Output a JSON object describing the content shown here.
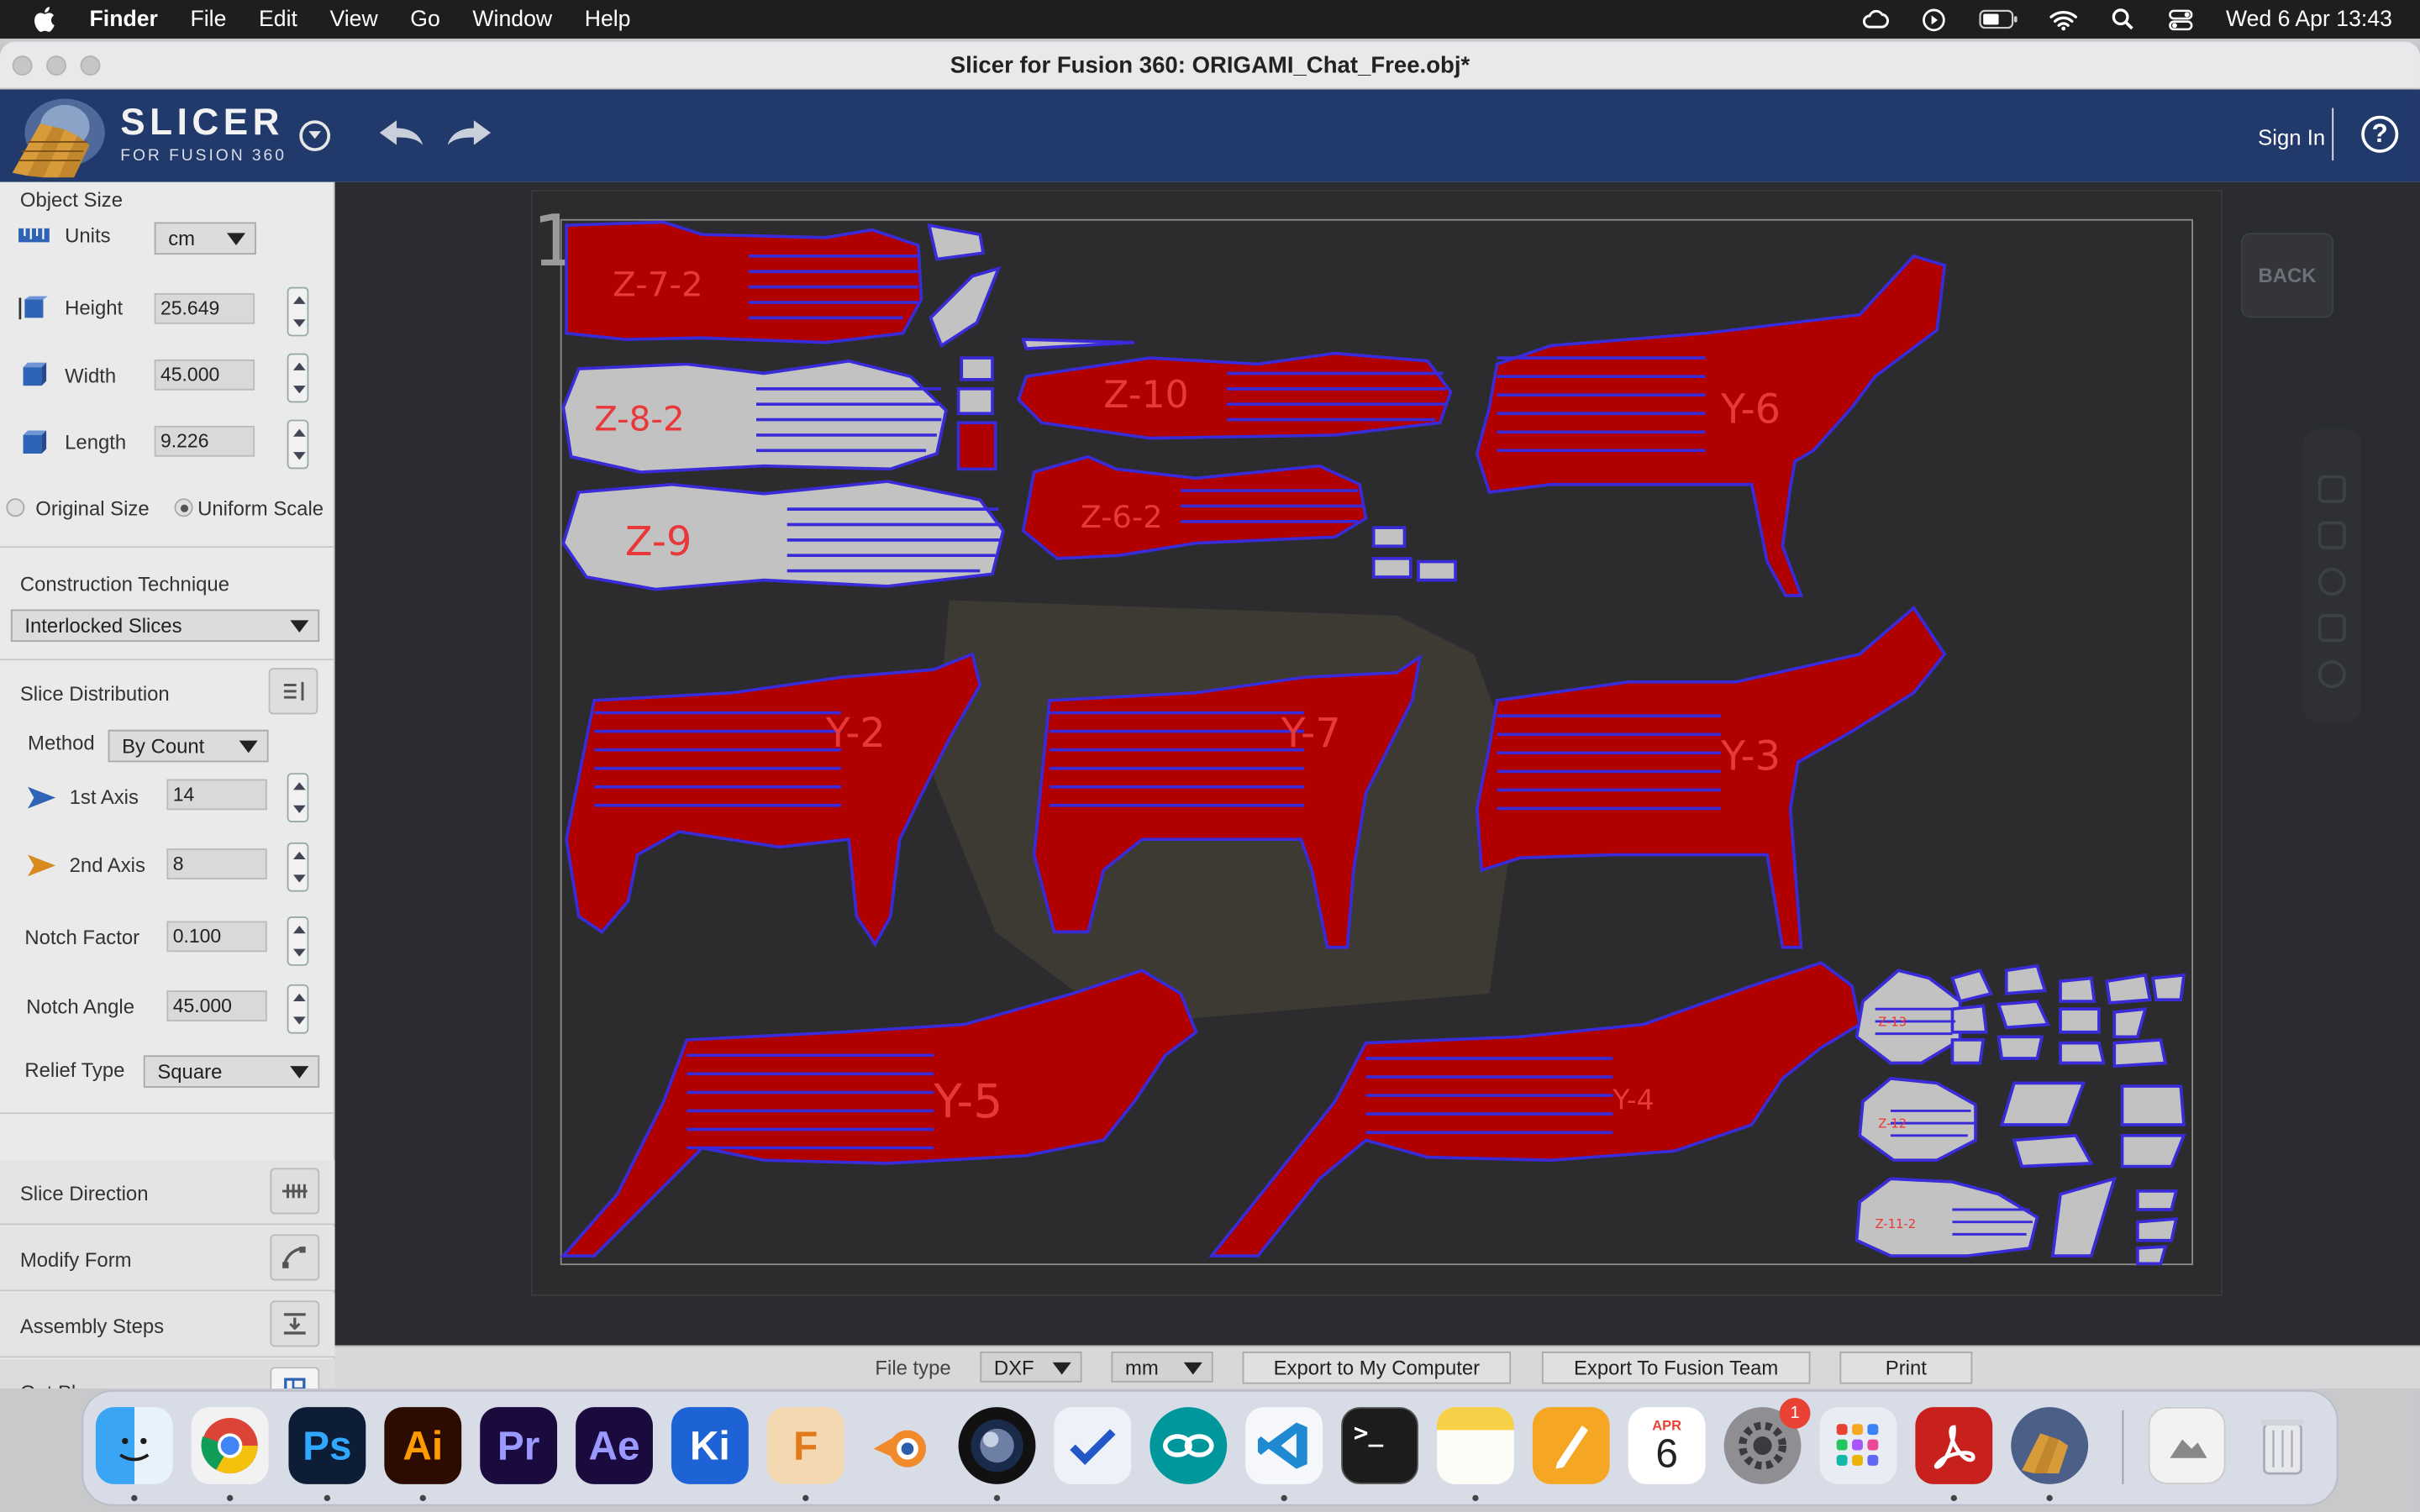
{
  "menubar": {
    "app": "Finder",
    "items": [
      "File",
      "Edit",
      "View",
      "Go",
      "Window",
      "Help"
    ],
    "clock": "Wed 6 Apr  13:43"
  },
  "window": {
    "title": "Slicer for Fusion 360: ORIGAMI_Chat_Free.obj*"
  },
  "header": {
    "brand_title": "SLICER",
    "brand_subtitle": "FOR FUSION 360",
    "sign_in": "Sign In",
    "help": "?"
  },
  "object_size": {
    "title": "Object Size",
    "units_label": "Units",
    "units_value": "cm",
    "height_label": "Height",
    "height_value": "25.649",
    "width_label": "Width",
    "width_value": "45.000",
    "length_label": "Length",
    "length_value": "9.226",
    "original_size": "Original Size",
    "uniform_scale": "Uniform Scale"
  },
  "construction": {
    "title": "Construction Technique",
    "value": "Interlocked Slices"
  },
  "slice_distribution": {
    "title": "Slice Distribution",
    "method_label": "Method",
    "method_value": "By Count",
    "axis1_label": "1st Axis",
    "axis1_value": "14",
    "axis2_label": "2nd Axis",
    "axis2_value": "8",
    "notch_factor_label": "Notch Factor",
    "notch_factor_value": "0.100",
    "notch_angle_label": "Notch Angle",
    "notch_angle_value": "45.000",
    "relief_type_label": "Relief Type",
    "relief_type_value": "Square"
  },
  "sections": {
    "slice_direction": "Slice Direction",
    "modify_form": "Modify Form",
    "assembly_steps": "Assembly Steps",
    "get_plans": "Get Plans"
  },
  "canvas": {
    "sheet_number": "1",
    "back_label": "BACK",
    "part_labels": [
      "Z-7-2",
      "Z-8-2",
      "Z-9",
      "Z-10",
      "Z-6-2",
      "Y-6",
      "Y-2",
      "Y-7",
      "Y-3",
      "Y-5",
      "Y-4",
      "Z-13",
      "Z-12",
      "Z-11-2"
    ]
  },
  "bottombar": {
    "file_type_label": "File type",
    "file_type_value": "DXF",
    "unit_value": "mm",
    "export_computer": "Export to My Computer",
    "export_team": "Export To Fusion Team",
    "print": "Print"
  },
  "dock": {
    "calendar_month": "APR",
    "calendar_day": "6",
    "settings_badge": "1",
    "apps": [
      "Finder",
      "Chrome",
      "Photoshop",
      "Illustrator",
      "Premiere Pro",
      "After Effects",
      "Kdenlive",
      "Fusion 360",
      "Blender",
      "Cinema 4D",
      "Toolbox",
      "Arduino",
      "VS Code",
      "Terminal",
      "Notes",
      "Pages",
      "Calendar",
      "System Preferences",
      "Launchpad",
      "Acrobat",
      "Slicer",
      "Preview",
      "Trash"
    ]
  },
  "colors": {
    "header_bg": "#21396b",
    "slice_red": "#b00000",
    "slice_gray": "#c2c2c2",
    "line_blue": "#3a2bd8"
  }
}
